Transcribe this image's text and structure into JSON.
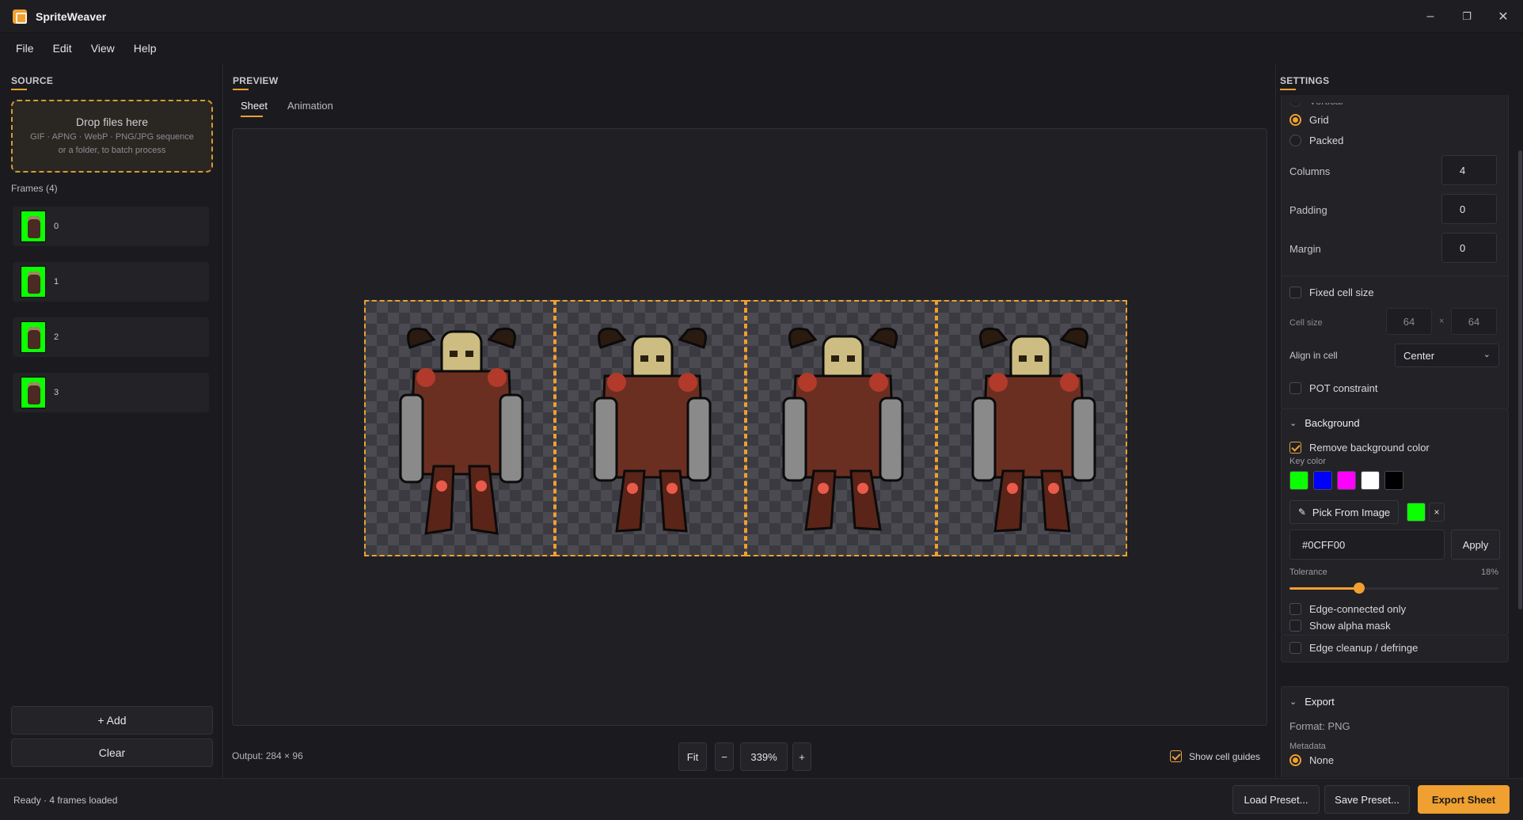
{
  "window": {
    "title": "SpriteWeaver",
    "minimize": "–",
    "maximize": "❐",
    "close": "✕"
  },
  "menu": [
    "File",
    "Edit",
    "View",
    "Help"
  ],
  "source": {
    "title": "SOURCE",
    "drop_title": "Drop files here",
    "drop_formats": "GIF · APNG · WebP · PNG/JPG sequence",
    "drop_hint": "or a folder, to batch process",
    "frames_label": "Frames (4)",
    "frames": [
      "0",
      "1",
      "2",
      "3"
    ],
    "add_label": "+ Add",
    "clear_label": "Clear"
  },
  "preview": {
    "title": "PREVIEW",
    "tabs": [
      "Sheet",
      "Animation"
    ],
    "active_tab": "Sheet",
    "output": "Output: 284 × 96",
    "fit": "Fit",
    "zoom_out": "−",
    "zoom": "339%",
    "zoom_in": "+",
    "show_guides_label": "Show cell guides",
    "show_guides": true
  },
  "settings": {
    "title": "SETTINGS",
    "layout_options": [
      {
        "label": "Vertical",
        "selected": false
      },
      {
        "label": "Grid",
        "selected": true
      },
      {
        "label": "Packed",
        "selected": false
      }
    ],
    "columns_label": "Columns",
    "columns": "4",
    "padding_label": "Padding",
    "padding": "0",
    "margin_label": "Margin",
    "margin": "0",
    "fixed_cell_label": "Fixed cell size",
    "fixed_cell": false,
    "cell_size_label": "Cell size",
    "cell_w": "64",
    "cell_sep": "×",
    "cell_h": "64",
    "align_label": "Align in cell",
    "align_value": "Center",
    "pot_label": "POT constraint",
    "pot": false,
    "background": {
      "title": "Background",
      "remove_bg_label": "Remove background color",
      "remove_bg": true,
      "key_color_label": "Key color",
      "swatches": [
        "#0cff00",
        "#0000ff",
        "#ff00ff",
        "#ffffff",
        "#000000"
      ],
      "pick_label": "Pick From Image",
      "current_color": "#0cff00",
      "clear_x": "×",
      "hex": "#0CFF00",
      "apply_label": "Apply",
      "tolerance_label": "Tolerance",
      "tolerance_value": "18%",
      "tolerance": 0.18,
      "edge_connected_label": "Edge-connected only",
      "edge_connected": false,
      "alpha_mask_label": "Show alpha mask",
      "alpha_mask": false,
      "defringe_label": "Edge cleanup / defringe",
      "defringe": false
    },
    "export": {
      "title": "Export",
      "format": "Format: PNG",
      "metadata_label": "Metadata",
      "metadata_value": "None"
    }
  },
  "status": {
    "text": "Ready · 4 frames loaded",
    "load_preset": "Load Preset...",
    "save_preset": "Save Preset...",
    "export_sheet": "Export Sheet"
  },
  "colors": {
    "accent": "#f0a030",
    "background": "#1b1b1f",
    "panel": "#222227"
  }
}
